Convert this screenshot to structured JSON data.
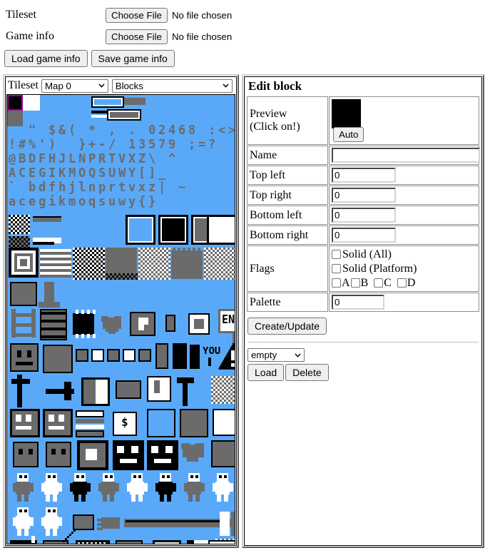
{
  "file_section": {
    "rows": [
      {
        "label": "Tileset",
        "button_label": "Choose File",
        "status": "No file chosen"
      },
      {
        "label": "Game info",
        "button_label": "Choose File",
        "status": "No file chosen"
      }
    ],
    "load_label": "Load game info",
    "save_label": "Save game info"
  },
  "tileset_panel": {
    "label": "Tileset",
    "map_select": {
      "value": "Map 0",
      "options": [
        "Map 0"
      ]
    },
    "mode_select": {
      "value": "Blocks",
      "options": [
        "Blocks"
      ]
    },
    "canvas": {
      "background_color": "#5aa9f8",
      "ink_color": "#6b6b6b",
      "dark_color": "#000000",
      "light_color": "#ffffff",
      "palette_swatches": [
        {
          "color": "#000000",
          "selected": true,
          "selection_color": "#a000a0"
        },
        {
          "color": "#ffffff",
          "selected": false
        },
        {
          "color": "#6b6b6b",
          "selected": false
        }
      ],
      "glyph_rows": [
        "  \" $&( * , . 02468 :<>",
        "!#%')  }+-/ 13579 ;=?",
        "@BDFHJLNPRTVXZ\\ ^",
        "ACEGIKMOQSUWY[]_",
        "` bdfhjlnprtvxz| ~",
        "acegikmoqsuwy{} "
      ]
    }
  },
  "edit_panel": {
    "title": "Edit block",
    "preview": {
      "label_line1": "Preview",
      "label_line2": "(Click on!)",
      "swatch_color": "#000000",
      "auto_label": "Auto"
    },
    "fields": [
      {
        "label": "Name",
        "value": "",
        "wide": true
      },
      {
        "label": "Top left",
        "value": "0",
        "wide": false
      },
      {
        "label": "Top right",
        "value": "0",
        "wide": false
      },
      {
        "label": "Bottom left",
        "value": "0",
        "wide": false
      },
      {
        "label": "Bottom right",
        "value": "0",
        "wide": false
      }
    ],
    "flags": {
      "label": "Flags",
      "solid_all": {
        "label": "Solid (All)",
        "checked": false
      },
      "solid_platform": {
        "label": "Solid (Platform)",
        "checked": false
      },
      "letters": [
        {
          "label": "A",
          "checked": false
        },
        {
          "label": "B",
          "checked": false
        },
        {
          "label": "C",
          "checked": false
        },
        {
          "label": "D",
          "checked": false
        }
      ]
    },
    "palette": {
      "label": "Palette",
      "value": "0"
    },
    "create_label": "Create/Update",
    "saved_select": {
      "value": "empty",
      "options": [
        "empty"
      ]
    },
    "load_label": "Load",
    "delete_label": "Delete"
  }
}
